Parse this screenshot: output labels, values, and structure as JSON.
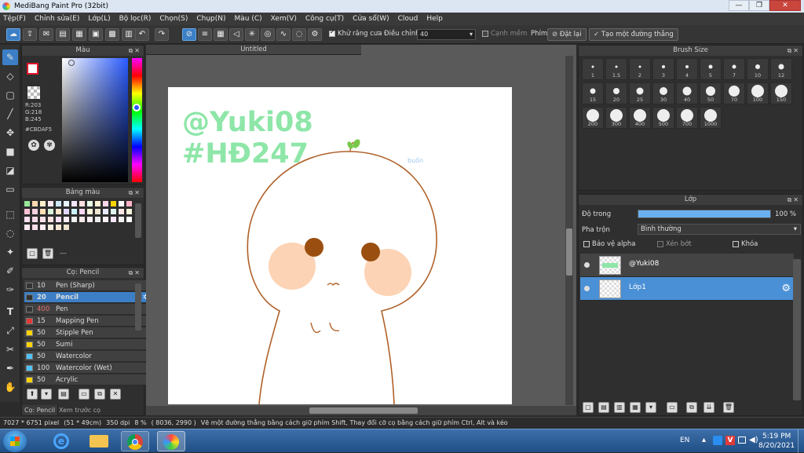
{
  "window": {
    "title": "MediBang Paint Pro (32bit)",
    "min": "—",
    "max": "❐",
    "close": "✕"
  },
  "menu": [
    "Tệp(F)",
    "Chỉnh sửa(E)",
    "Lớp(L)",
    "Bộ lọc(R)",
    "Chọn(S)",
    "Chụp(N)",
    "Màu (C)",
    "Xem(V)",
    "Công cụ(T)",
    "Cửa sổ(W)",
    "Cloud",
    "Help"
  ],
  "toolbar": {
    "antialias_label": "Khử răng cưa",
    "adjust_label": "Điều chỉnh",
    "adjust_value": "40",
    "soft_edge_label": "Cạnh mềm",
    "key_label": "Phím",
    "reset_label": "Đặt lại",
    "straight_line_label": "Tạo một đường thẳng"
  },
  "color_panel": {
    "title": "Màu",
    "r": "R:203",
    "g": "G:218",
    "b": "B:245",
    "hex": "#CBDAF5",
    "current_color": "#cbdaf5",
    "primary_color": "#e0142a"
  },
  "palette_panel": {
    "title": "Bảng màu",
    "colors": [
      "#9ae89a",
      "#ffd9b3",
      "#fff1cc",
      "#ffe9f2",
      "#cfe8ff",
      "#e6f7ff",
      "#f2e6ff",
      "#ffe0e0",
      "#e8ffe8",
      "#fff3d6",
      "#ffd6e8",
      "#ffd400",
      "#ffffff",
      "#ffb3c6",
      "#ffc2d6",
      "#f7d0e0",
      "#ffe1b5",
      "#d9f2d9",
      "#ffe6cc",
      "#e0d7ff",
      "#ccf2ff",
      "#ffd9f2",
      "#fff8dc",
      "#f0e6d2",
      "#e8e8ff",
      "#dff7f0",
      "#ffe7e7",
      "#f5f5dc",
      "#fde0ef",
      "#f3d9e8",
      "#fce4ec",
      "#ffe4e1",
      "#f8e1f4",
      "#ffedf5",
      "#f0f0f0",
      "#fbeaea",
      "#fdf0f5",
      "#ececec",
      "#fff0f5",
      "#fae6fa",
      "#f2f2f2",
      "#ffffff",
      "#fce8f0",
      "#f9dde9",
      "#fdeef4",
      "#f6f0e0",
      "#f5e9d4",
      "#efe4cf"
    ],
    "footer_text": "---"
  },
  "brush_panel": {
    "title": "Cọ: Pencil",
    "items": [
      {
        "size": "10",
        "name": "Pen (Sharp)",
        "color": "#333333"
      },
      {
        "size": "20",
        "name": "Pencil",
        "color": "#333333"
      },
      {
        "size": "400",
        "name": "Pen",
        "color": "#333333"
      },
      {
        "size": "15",
        "name": "Mapping Pen",
        "color": "#e53935"
      },
      {
        "size": "50",
        "name": "Stipple Pen",
        "color": "#ffd400"
      },
      {
        "size": "50",
        "name": "Sumi",
        "color": "#ffd400"
      },
      {
        "size": "50",
        "name": "Watercolor",
        "color": "#4fc3f7"
      },
      {
        "size": "100",
        "name": "Watercolor (Wet)",
        "color": "#4fc3f7"
      },
      {
        "size": "50",
        "name": "Acrylic",
        "color": "#ffd400"
      }
    ],
    "tabs": [
      "Cọ: Pencil",
      "Xem trước cọ"
    ]
  },
  "canvas": {
    "doc_title": "Untitled",
    "text_line1": "@Yuki08",
    "text_line2": "#HĐ247",
    "signature": "buồn"
  },
  "brush_size_panel": {
    "title": "Brush Size",
    "sizes": [
      "1",
      "1.5",
      "2",
      "3",
      "4",
      "5",
      "7",
      "10",
      "12",
      "15",
      "20",
      "25",
      "30",
      "40",
      "50",
      "70",
      "100",
      "150",
      "200",
      "300",
      "400",
      "500",
      "700",
      "1000"
    ]
  },
  "layer_panel": {
    "title": "Lớp",
    "opacity_label": "Độ trong",
    "opacity_value": "100 %",
    "opacity_fraction": 1.0,
    "blend_label": "Pha trộn",
    "blend_value": "Bình thường",
    "protect_alpha": "Bảo vệ alpha",
    "clipping": "Xén bớt",
    "lock": "Khóa",
    "layers": [
      {
        "name": "@Yuki08",
        "selected": false
      },
      {
        "name": "Lớp1",
        "selected": true
      }
    ]
  },
  "status": {
    "size": "7027 * 6751 pixel",
    "cm": "(51 * 49cm)",
    "dpi": "350 dpi",
    "zoom": "8 %",
    "coords": "( 8036, 2990 )",
    "hint": "Vẽ một đường thẳng bằng cách giữ phím Shift, Thay đổi cỡ cọ bằng cách giữ phím Ctrl, Alt và kéo"
  },
  "taskbar": {
    "lang": "EN",
    "time": "5:19 PM",
    "date": "8/20/2021"
  }
}
